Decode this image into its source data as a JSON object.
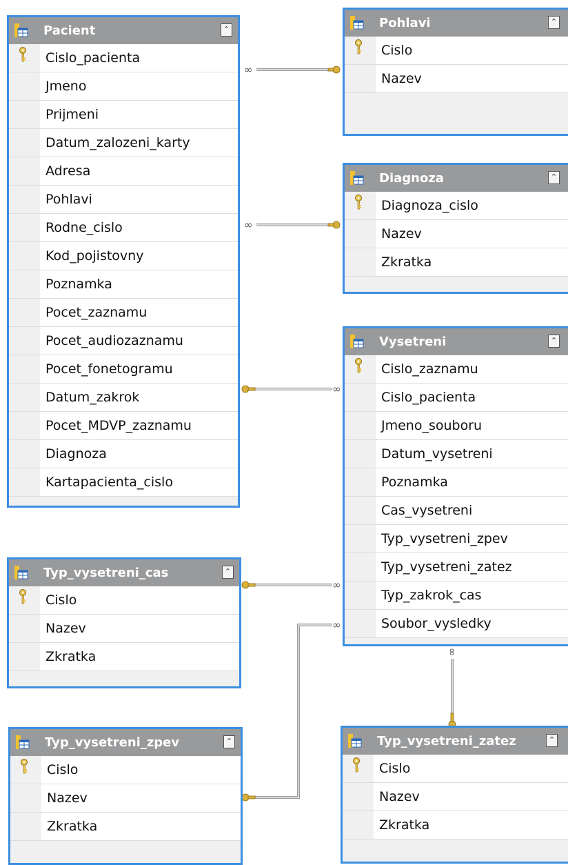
{
  "tables": {
    "pacient": {
      "name": "Pacient",
      "columns": [
        "Cislo_pacienta",
        "Jmeno",
        "Prijmeni",
        "Datum_zalozeni_karty",
        "Adresa",
        "Pohlavi",
        "Rodne_cislo",
        "Kod_pojistovny",
        "Poznamka",
        "Pocet_zaznamu",
        "Pocet_audiozaznamu",
        "Pocet_fonetogramu",
        "Datum_zakrok",
        "Pocet_MDVP_zaznamu",
        "Diagnoza",
        "Kartapacienta_cislo"
      ],
      "key_column": "Cislo_pacienta"
    },
    "pohlavi": {
      "name": "Pohlavi",
      "columns": [
        "Cislo",
        "Nazev"
      ],
      "key_column": "Cislo"
    },
    "diagnoza": {
      "name": "Diagnoza",
      "columns": [
        "Diagnoza_cislo",
        "Nazev",
        "Zkratka"
      ],
      "key_column": "Diagnoza_cislo"
    },
    "vysetreni": {
      "name": "Vysetreni",
      "columns": [
        "Cislo_zaznamu",
        "Cislo_pacienta",
        "Jmeno_souboru",
        "Datum_vysetreni",
        "Poznamka",
        "Cas_vysetreni",
        "Typ_vysetreni_zpev",
        "Typ_vysetreni_zatez",
        "Typ_zakrok_cas",
        "Soubor_vysledky"
      ],
      "key_column": "Cislo_zaznamu"
    },
    "typ_cas": {
      "name": "Typ_vysetreni_cas",
      "columns": [
        "Cislo",
        "Nazev",
        "Zkratka"
      ],
      "key_column": "Cislo"
    },
    "typ_zpev": {
      "name": "Typ_vysetreni_zpev",
      "columns": [
        "Cislo",
        "Nazev",
        "Zkratka"
      ],
      "key_column": "Cislo"
    },
    "typ_zatez": {
      "name": "Typ_vysetreni_zatez",
      "columns": [
        "Cislo",
        "Nazev",
        "Zkratka"
      ],
      "key_column": "Cislo"
    }
  },
  "relationships": [
    {
      "from": "Pacient",
      "to": "Pohlavi",
      "many_end": "Pacient",
      "one_end": "Pohlavi"
    },
    {
      "from": "Pacient",
      "to": "Diagnoza",
      "many_end": "Pacient",
      "one_end": "Diagnoza"
    },
    {
      "from": "Pacient",
      "to": "Vysetreni",
      "many_end": "Vysetreni",
      "one_end": "Pacient"
    },
    {
      "from": "Typ_vysetreni_cas",
      "to": "Vysetreni",
      "many_end": "Vysetreni",
      "one_end": "Typ_vysetreni_cas"
    },
    {
      "from": "Typ_vysetreni_zpev",
      "to": "Vysetreni",
      "many_end": "Vysetreni",
      "one_end": "Typ_vysetreni_zpev"
    },
    {
      "from": "Typ_vysetreni_zatez",
      "to": "Vysetreni",
      "many_end": "Vysetreni",
      "one_end": "Typ_vysetreni_zatez"
    }
  ],
  "icons": {
    "table": "table-icon",
    "key": "primary-key-icon",
    "collapse": "collapse-chevron-icon"
  },
  "colors": {
    "header": "#999a9c",
    "border": "#3c8fe0",
    "line": "#9a9a9a",
    "key": "#d9b13a"
  }
}
